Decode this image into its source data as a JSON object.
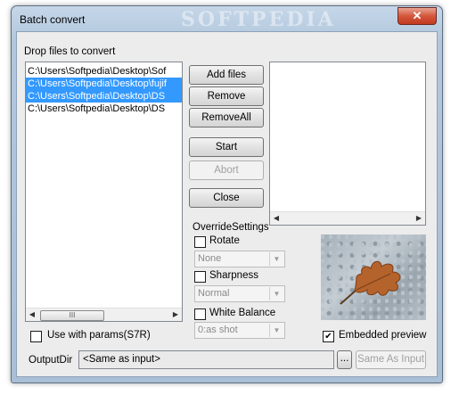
{
  "window": {
    "title": "Batch convert",
    "watermark": "SOFTPEDIA",
    "close_glyph": "✕"
  },
  "drop_label": "Drop files to convert",
  "files": [
    {
      "path": "C:\\Users\\Softpedia\\Desktop\\Sof",
      "selected": false
    },
    {
      "path": "C:\\Users\\Softpedia\\Desktop\\fujif",
      "selected": true
    },
    {
      "path": "C:\\Users\\Softpedia\\Desktop\\DS",
      "selected": true
    },
    {
      "path": "C:\\Users\\Softpedia\\Desktop\\DS",
      "selected": false
    }
  ],
  "buttons": {
    "add_files": "Add files",
    "remove": "Remove",
    "remove_all": "RemoveAll",
    "start": "Start",
    "abort": "Abort",
    "close": "Close",
    "browse": "...",
    "same_as_input": "Same As Input"
  },
  "override": {
    "label": "OverrideSettings",
    "rotate": {
      "label": "Rotate",
      "checked": false,
      "value": "None"
    },
    "sharpness": {
      "label": "Sharpness",
      "checked": false,
      "value": "Normal"
    },
    "white_balance": {
      "label": "White Balance",
      "checked": false,
      "value": "0:as shot"
    }
  },
  "use_params": {
    "label": "Use with params(S7R)",
    "checked": false
  },
  "embedded_preview": {
    "label": "Embedded preview",
    "checked": true,
    "check_glyph": "✔"
  },
  "output": {
    "label": "OutputDir",
    "value": "<Same as input>"
  },
  "scroll": {
    "left_glyph": "◀",
    "right_glyph": "▶",
    "thumb_glyph": "III",
    "drop_glyph": "▼"
  },
  "icons": [
    "close-icon",
    "scroll-left-icon",
    "scroll-right-icon",
    "dropdown-arrow-icon",
    "checkmark-icon"
  ]
}
